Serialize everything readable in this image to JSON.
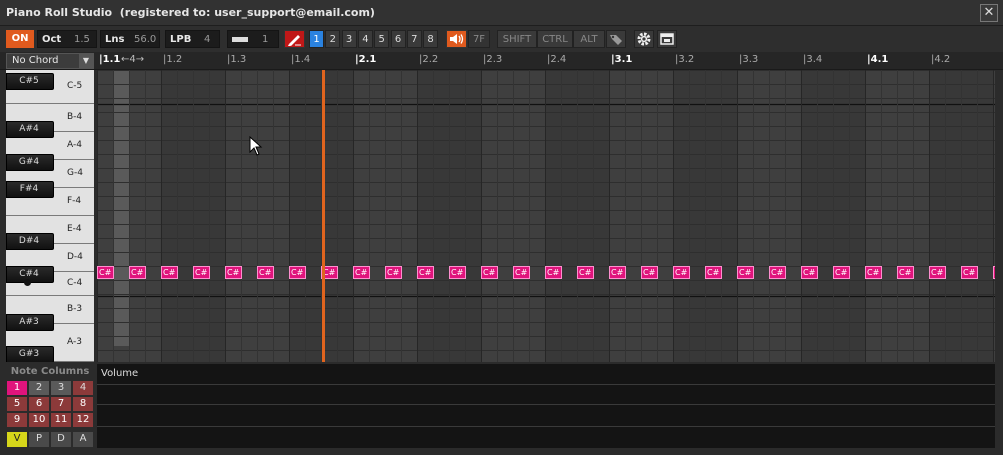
{
  "window": {
    "title": "Piano Roll Studio  (registered to: user_support@email.com)",
    "close_label": "✕"
  },
  "toolbar": {
    "on_label": "ON",
    "oct_label": "Oct",
    "oct_value": "1.5",
    "lns_label": "Lns",
    "lns_value": "56.0",
    "lpb_label": "LPB",
    "lpb_value": "4",
    "step_value": "1",
    "track_buttons": [
      "1",
      "2",
      "3",
      "4",
      "5",
      "6",
      "7",
      "8"
    ],
    "active_track": "1",
    "vol_value": "7F",
    "shift_label": "SHIFT",
    "ctrl_label": "CTRL",
    "alt_label": "ALT"
  },
  "ruler": {
    "chord_select": "No Chord",
    "loop_marker": "←4→",
    "beats": [
      "1.1",
      "1.2",
      "1.3",
      "1.4",
      "2.1",
      "2.2",
      "2.3",
      "2.4",
      "3.1",
      "3.2",
      "3.3",
      "3.4",
      "4.1",
      "4.2"
    ]
  },
  "keyboard": {
    "white_keys": [
      "C-5",
      "B-4",
      "A-4",
      "G-4",
      "F-4",
      "E-4",
      "D-4",
      "C-4",
      "B-3",
      "A-3"
    ],
    "black_keys": [
      "C#5",
      "A#4",
      "G#4",
      "F#4",
      "D#4",
      "C#4",
      "A#3",
      "G#3"
    ]
  },
  "notes": {
    "label": "C#",
    "count": 29
  },
  "note_columns": {
    "title": "Note Columns",
    "buttons": [
      "1",
      "2",
      "3",
      "4",
      "5",
      "6",
      "7",
      "8",
      "9",
      "10",
      "11",
      "12"
    ],
    "active": "1",
    "modes": [
      "V",
      "P",
      "D",
      "A"
    ],
    "active_mode": "V"
  },
  "automation": {
    "label": "Volume"
  },
  "colors": {
    "accent_orange": "#e05a1e",
    "note_pink": "#e0147c",
    "active_blue": "#2a82e0",
    "playhead": "#e0641e"
  }
}
